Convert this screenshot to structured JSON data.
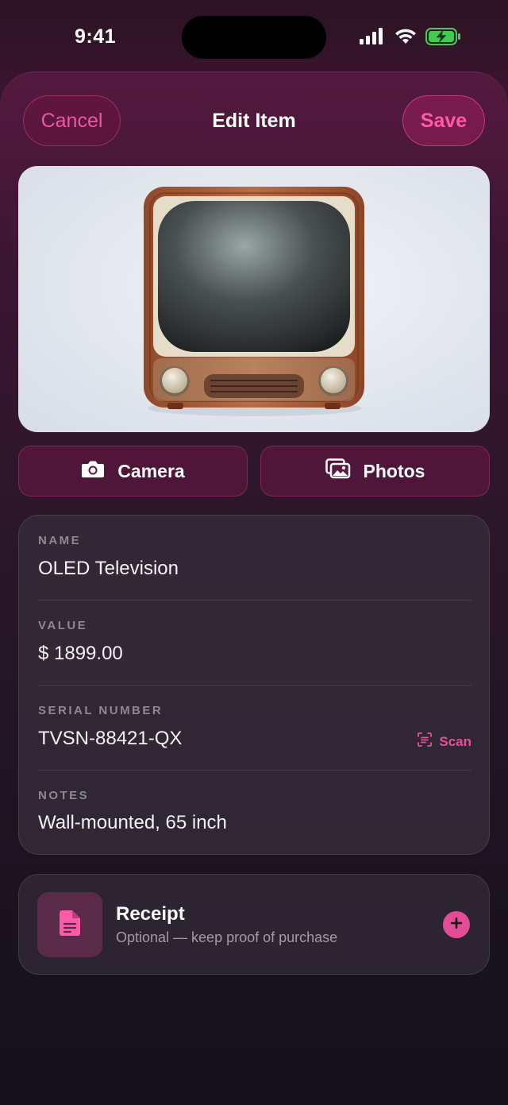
{
  "status_bar": {
    "time": "9:41"
  },
  "header": {
    "cancel_label": "Cancel",
    "title": "Edit Item",
    "save_label": "Save"
  },
  "photo": {
    "subject": "television"
  },
  "photo_actions": {
    "camera_label": "Camera",
    "photos_label": "Photos"
  },
  "form": {
    "name": {
      "label": "NAME",
      "value": "OLED Television"
    },
    "value": {
      "label": "VALUE",
      "value": "$ 1899.00"
    },
    "serial": {
      "label": "SERIAL NUMBER",
      "value": "TVSN-88421-QX",
      "scan_label": "Scan"
    },
    "notes": {
      "label": "NOTES",
      "value": "Wall-mounted, 65 inch"
    }
  },
  "receipt": {
    "title": "Receipt",
    "subtitle": "Optional — keep proof of purchase"
  },
  "colors": {
    "accent": "#e54c97",
    "card": "#342c38",
    "background": "#1b1320"
  },
  "icons": [
    "signal-icon",
    "wifi-icon",
    "battery-charging-icon",
    "camera-icon",
    "photos-icon",
    "scan-icon",
    "document-icon",
    "plus-icon"
  ]
}
